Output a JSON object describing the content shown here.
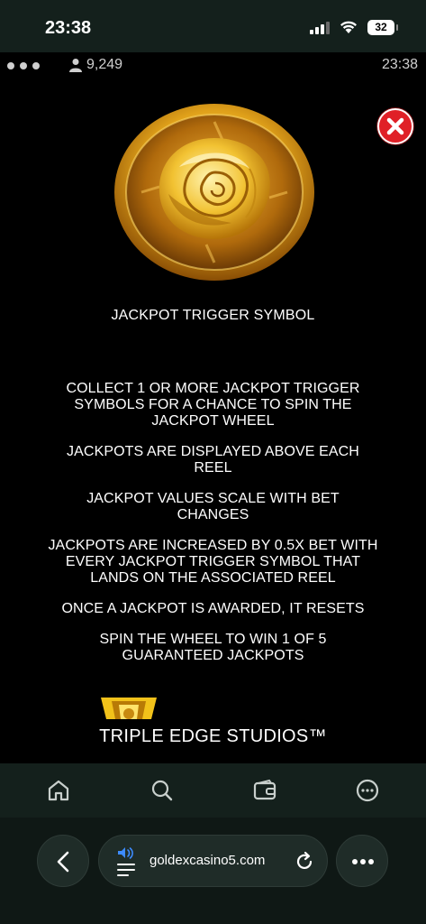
{
  "status_bar": {
    "time": "23:38",
    "battery": "32"
  },
  "game_bar": {
    "players_count": "9,249",
    "clock": "23:38"
  },
  "symbol": {
    "title": "JACKPOT TRIGGER SYMBOL"
  },
  "rules": [
    "COLLECT 1 OR MORE JACKPOT TRIGGER SYMBOLS FOR A CHANCE TO SPIN THE JACKPOT WHEEL",
    "JACKPOTS ARE DISPLAYED ABOVE EACH REEL",
    "JACKPOT VALUES SCALE WITH BET CHANGES",
    "JACKPOTS ARE INCREASED BY 0.5X BET WITH EVERY JACKPOT TRIGGER SYMBOL THAT LANDS ON THE ASSOCIATED REEL",
    "ONCE A JACKPOT IS AWARDED, IT RESETS",
    "SPIN THE WHEEL TO WIN 1 OF 5 GUARANTEED JACKPOTS"
  ],
  "studio": {
    "name": "TRIPLE EDGE STUDIOS™"
  },
  "browser": {
    "url": "goldexcasino5.com",
    "tabs": [
      "home-icon",
      "search-icon",
      "wallet-icon",
      "more-circle-icon"
    ]
  },
  "colors": {
    "close_red": "#e02027",
    "gold": "#d9a21b",
    "toolbar_bg": "#14201c"
  }
}
